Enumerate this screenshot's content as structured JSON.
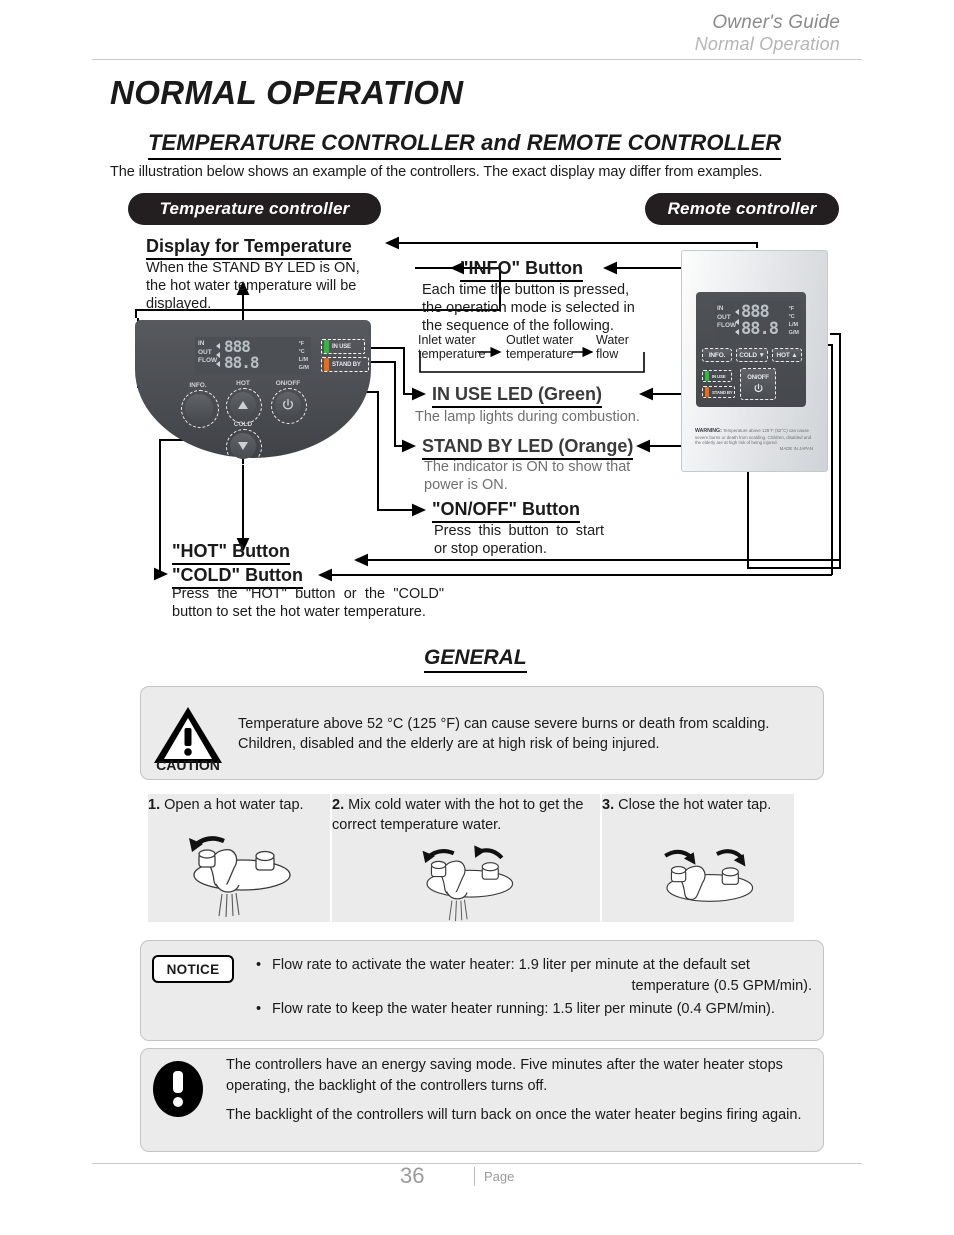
{
  "header": {
    "line1": "Owner's Guide",
    "line2": "Normal Operation"
  },
  "titles": {
    "h1": "NORMAL OPERATION",
    "section1": "TEMPERATURE CONTROLLER and REMOTE CONTROLLER",
    "intro": "The illustration below shows an example of the controllers. The exact display may differ from examples.",
    "section2": "GENERAL"
  },
  "pills": {
    "temperature_controller": "Temperature controller",
    "remote_controller": "Remote controller"
  },
  "callouts": {
    "display": {
      "title": "Display for Temperature",
      "body": "When the STAND BY LED is ON, the hot water temperature will be displayed."
    },
    "info": {
      "title": "\"INFO\" Button",
      "body": "Each time the button is pressed, the operation mode is selected in the sequence of the following.",
      "sequence": [
        "Inlet water temperature",
        "Outlet water temperature",
        "Water flow"
      ]
    },
    "in_use_led": {
      "title": "IN USE LED (Green)",
      "body": "The lamp lights during combustion."
    },
    "stand_by_led": {
      "title": "STAND BY LED (Orange)",
      "body": "The indicator is ON to show that power is ON."
    },
    "onoff": {
      "title": "\"ON/OFF\" Button",
      "body": "Press this button to start or stop operation."
    },
    "hot": {
      "title": "\"HOT\" Button"
    },
    "cold": {
      "title": "\"COLD\" Button",
      "body": "Press the \"HOT\" button or the \"COLD\" button to set the hot water temperature."
    }
  },
  "temp_controller": {
    "lcd": {
      "rows": [
        "IN",
        "OUT",
        "FLOW"
      ],
      "digits_top": "888",
      "digits_bottom": "88.8",
      "units": [
        "°F",
        "°C",
        "L/M",
        "G/M"
      ]
    },
    "leds": [
      {
        "name": "IN USE",
        "color": "#2bbd3a"
      },
      {
        "name": "STAND BY",
        "color": "#f06a12"
      }
    ],
    "buttons": [
      {
        "label": "INFO."
      },
      {
        "label": "HOT"
      },
      {
        "label": "ON/OFF"
      },
      {
        "label": "COLD"
      }
    ]
  },
  "remote_controller": {
    "lcd": {
      "rows": [
        "IN",
        "OUT",
        "FLOW"
      ],
      "digits_top": "888",
      "digits_bottom": "88.8",
      "units": [
        "°F",
        "°C",
        "L/M",
        "G/M"
      ]
    },
    "buttons": [
      {
        "label": "INFO."
      },
      {
        "label": "COLD ▼"
      },
      {
        "label": "HOT ▲"
      },
      {
        "label": "ON/OFF"
      }
    ],
    "leds": [
      {
        "name": "IN USE",
        "color": "#2bbd3a"
      },
      {
        "name": "STAND BY",
        "color": "#f06a12"
      }
    ],
    "warning": {
      "bold": "WARNING:",
      "text": " Temperature above 125°F (52°C) can cause severe burns or death from scalding. Children, disabled and the elderly are at high risk of being injured.",
      "made_in": "MADE IN JAPAN"
    }
  },
  "caution": {
    "word": "CAUTION",
    "text": "Temperature above 52 °C (125 °F) can cause severe burns or death from scalding. Children, disabled and the elderly are at high risk of being injured."
  },
  "steps": [
    {
      "num": "1.",
      "text": " Open a hot water tap."
    },
    {
      "num": "2.",
      "text": " Mix cold water with the hot to get the correct temperature water."
    },
    {
      "num": "3.",
      "text": " Close the hot water tap."
    }
  ],
  "notice": {
    "badge": "NOTICE",
    "items": [
      {
        "line1": "Flow rate to activate the water heater: 1.9 liter per minute at the default set",
        "line2": "temperature (0.5 GPM/min)."
      },
      {
        "line1": "Flow rate to keep the water heater running: 1.5 liter per minute (0.4 GPM/min).",
        "line2": ""
      }
    ]
  },
  "energy": {
    "p1": "The controllers have an energy saving mode. Five minutes after the water heater stops operating, the backlight of the controllers turns off.",
    "p2": "The backlight of the controllers will turn back on once the water heater begins firing again."
  },
  "footer": {
    "page_number": "36",
    "page_word": "Page"
  },
  "colors": {
    "panel_bg": "#ebebeb",
    "panel_border": "#c4c4c4",
    "pill_bg": "#231f20",
    "led_green": "#2bbd3a",
    "led_orange": "#f06a12",
    "rule": "#c9c9c9"
  }
}
